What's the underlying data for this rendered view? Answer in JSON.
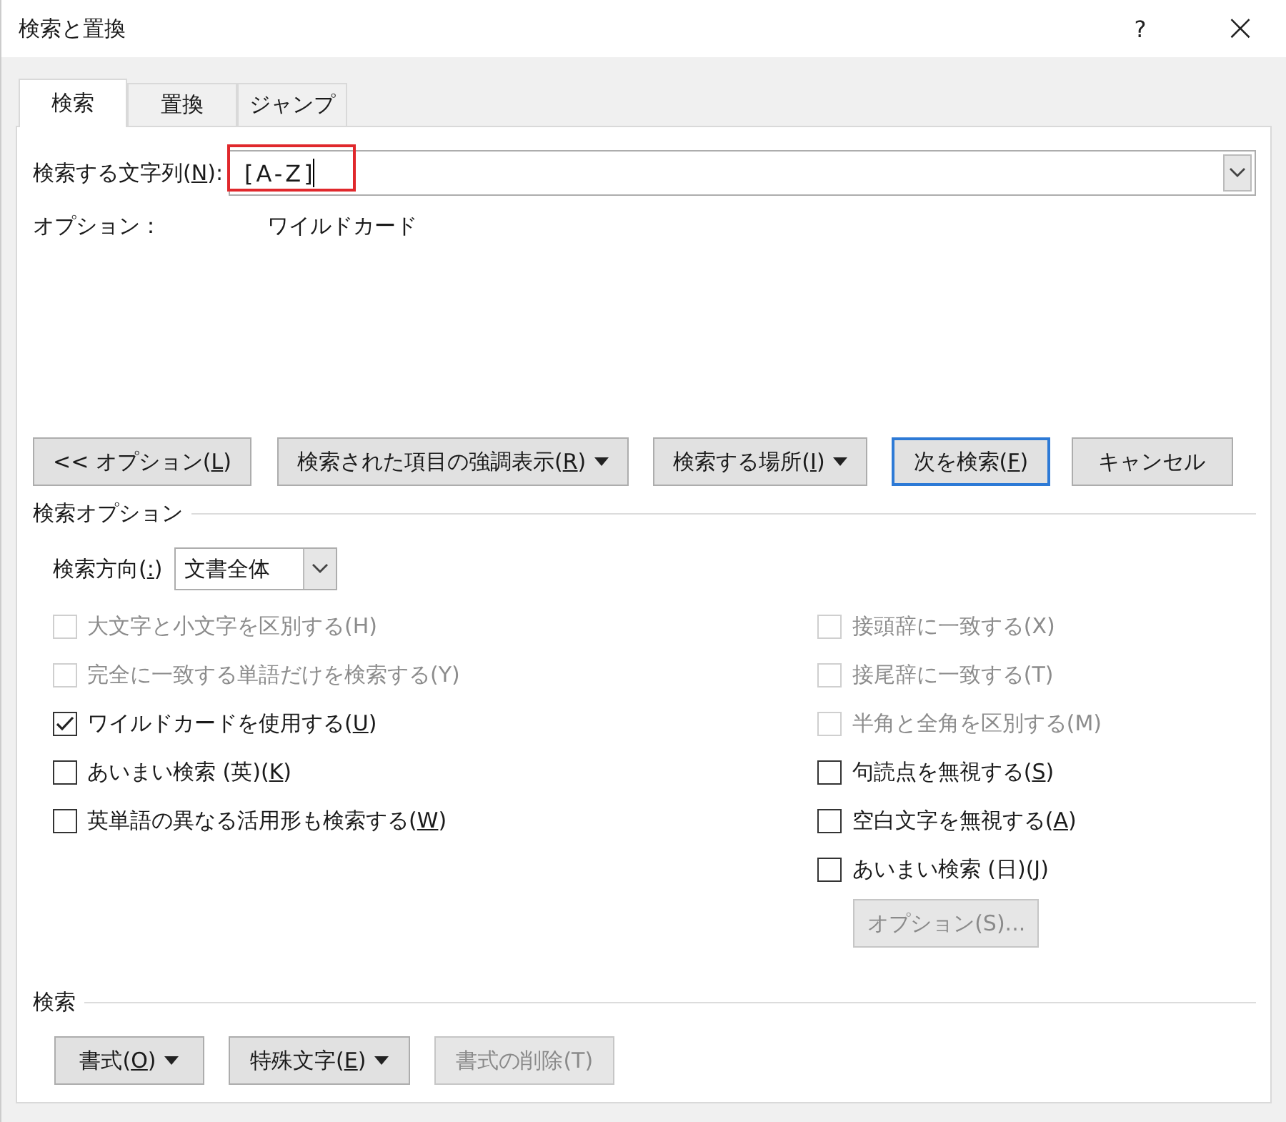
{
  "window": {
    "title": "検索と置換",
    "help": "?",
    "close": "×"
  },
  "tabs": [
    {
      "label": "検索",
      "selected": true
    },
    {
      "label": "置換",
      "selected": false
    },
    {
      "label": "ジャンプ",
      "selected": false
    }
  ],
  "find": {
    "label": {
      "pre": "検索する文字列(",
      "key": "N",
      "post": "):"
    },
    "value": "[A-Z]",
    "highlighted": true
  },
  "options_line": {
    "label": "オプション：",
    "value": "ワイルドカード"
  },
  "buttons": [
    {
      "label": {
        "pre": "<< オプション(",
        "key": "L",
        "post": ")"
      },
      "menu": false,
      "default": false
    },
    {
      "label": {
        "pre": "検索された項目の強調表示(",
        "key": "R",
        "post": ")"
      },
      "menu": true,
      "default": false
    },
    {
      "label": {
        "pre": "検索する場所(",
        "key": "I",
        "post": ")"
      },
      "menu": true,
      "default": false
    },
    {
      "label": {
        "pre": "次を検索(",
        "key": "F",
        "post": ")"
      },
      "menu": false,
      "default": true
    },
    {
      "label": {
        "pre": "キャンセル"
      },
      "menu": false,
      "default": false
    }
  ],
  "search_options": {
    "title": "検索オプション",
    "direction_label": {
      "pre": "検索方向(",
      "key": ":",
      "post": ")"
    },
    "direction_value": "文書全体",
    "left": [
      {
        "label": {
          "pre": "大文字と小文字を区別する(H)"
        },
        "checked": false,
        "disabled": true
      },
      {
        "label": {
          "pre": "完全に一致する単語だけを検索する(Y)"
        },
        "checked": false,
        "disabled": true
      },
      {
        "label": {
          "pre": "ワイルドカードを使用する(",
          "key": "U",
          "post": ")"
        },
        "checked": true,
        "disabled": false
      },
      {
        "label": {
          "pre": "あいまい検索 (英)(",
          "key": "K",
          "post": ")"
        },
        "checked": false,
        "disabled": false
      },
      {
        "label": {
          "pre": "英単語の異なる活用形も検索する(",
          "key": "W",
          "post": ")"
        },
        "checked": false,
        "disabled": false
      }
    ],
    "right": [
      {
        "label": {
          "pre": "接頭辞に一致する(X)"
        },
        "checked": false,
        "disabled": true
      },
      {
        "label": {
          "pre": "接尾辞に一致する(T)"
        },
        "checked": false,
        "disabled": true
      },
      {
        "label": {
          "pre": "半角と全角を区別する(M)"
        },
        "checked": false,
        "disabled": true
      },
      {
        "label": {
          "pre": "句読点を無視する(",
          "key": "S",
          "post": ")"
        },
        "checked": false,
        "disabled": false
      },
      {
        "label": {
          "pre": "空白文字を無視する(",
          "key": "A",
          "post": ")"
        },
        "checked": false,
        "disabled": false
      },
      {
        "label": {
          "pre": "あいまい検索 (日)(",
          "key": "J",
          "post": ")"
        },
        "checked": false,
        "disabled": false
      }
    ],
    "options_button": {
      "label": {
        "pre": "オプション(S)..."
      },
      "disabled": true
    }
  },
  "search_group": {
    "title": "検索",
    "buttons": [
      {
        "label": {
          "pre": "書式(",
          "key": "O",
          "post": ")"
        },
        "menu": true,
        "disabled": false
      },
      {
        "label": {
          "pre": "特殊文字(",
          "key": "E",
          "post": ")"
        },
        "menu": true,
        "disabled": false
      },
      {
        "label": {
          "pre": "書式の削除(T)"
        },
        "menu": false,
        "disabled": true
      }
    ]
  }
}
